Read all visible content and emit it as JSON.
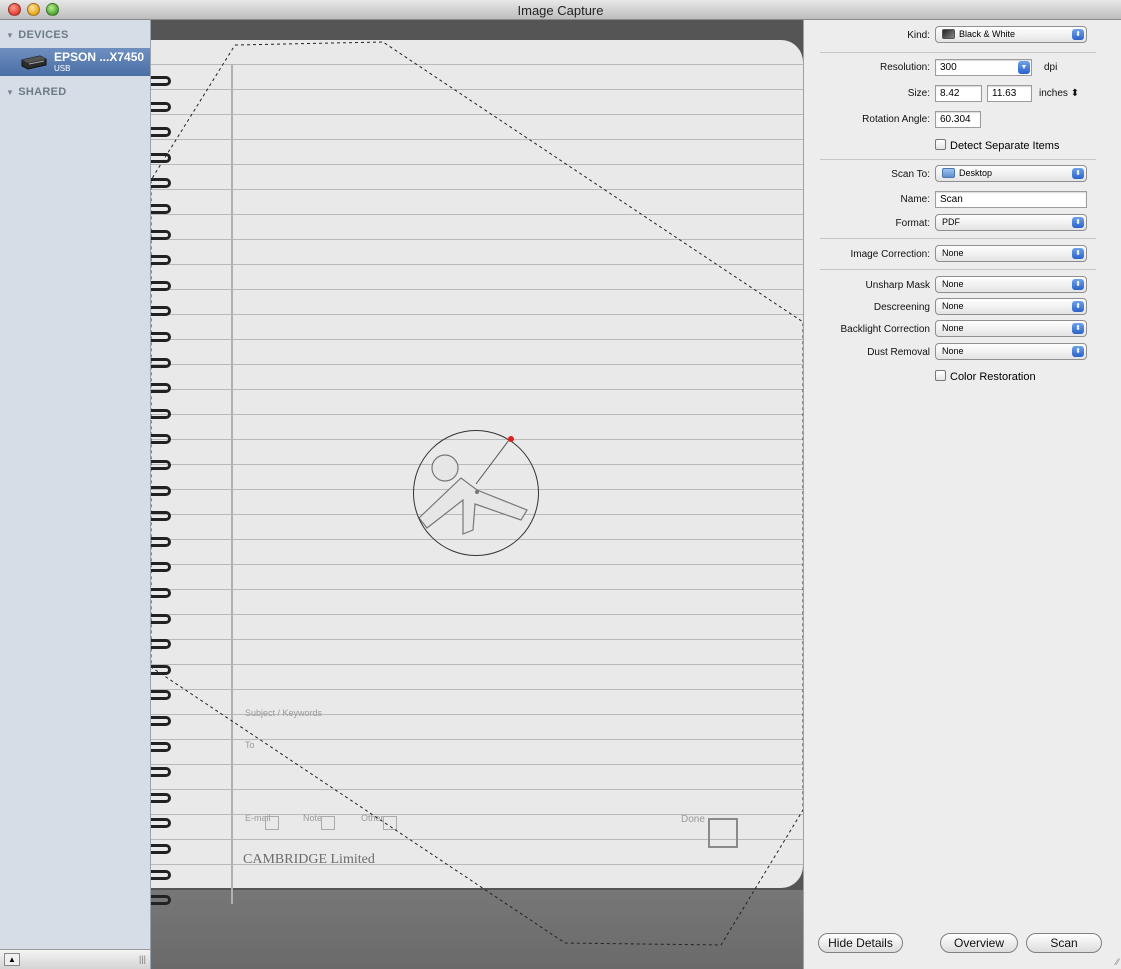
{
  "window": {
    "title": "Image Capture"
  },
  "sidebar": {
    "devices_header": "DEVICES",
    "shared_header": "SHARED",
    "device": {
      "name": "EPSON ...X7450",
      "connection": "USB"
    }
  },
  "preview": {
    "notebook": {
      "subject_label": "Subject / Keywords",
      "to_label": "To",
      "email_label": "E-mail",
      "note_label": "Note",
      "other_label": "Other",
      "done_label": "Done",
      "brand": "CAMBRIDGE Limited"
    }
  },
  "panel": {
    "kind": {
      "label": "Kind:",
      "value": "Black & White"
    },
    "resolution": {
      "label": "Resolution:",
      "value": "300",
      "unit": "dpi"
    },
    "size": {
      "label": "Size:",
      "width": "8.42",
      "height": "11.63",
      "unit": "inches"
    },
    "rotation": {
      "label": "Rotation Angle:",
      "value": "60.304"
    },
    "detect_separate": {
      "label": "Detect Separate Items",
      "checked": false
    },
    "scan_to": {
      "label": "Scan To:",
      "value": "Desktop"
    },
    "name": {
      "label": "Name:",
      "value": "Scan"
    },
    "format": {
      "label": "Format:",
      "value": "PDF"
    },
    "image_correction": {
      "label": "Image Correction:",
      "value": "None"
    },
    "unsharp_mask": {
      "label": "Unsharp Mask",
      "value": "None"
    },
    "descreening": {
      "label": "Descreening",
      "value": "None"
    },
    "backlight_correction": {
      "label": "Backlight Correction",
      "value": "None"
    },
    "dust_removal": {
      "label": "Dust Removal",
      "value": "None"
    },
    "color_restoration": {
      "label": "Color Restoration",
      "checked": false
    }
  },
  "buttons": {
    "hide_details": "Hide Details",
    "overview": "Overview",
    "scan": "Scan"
  }
}
